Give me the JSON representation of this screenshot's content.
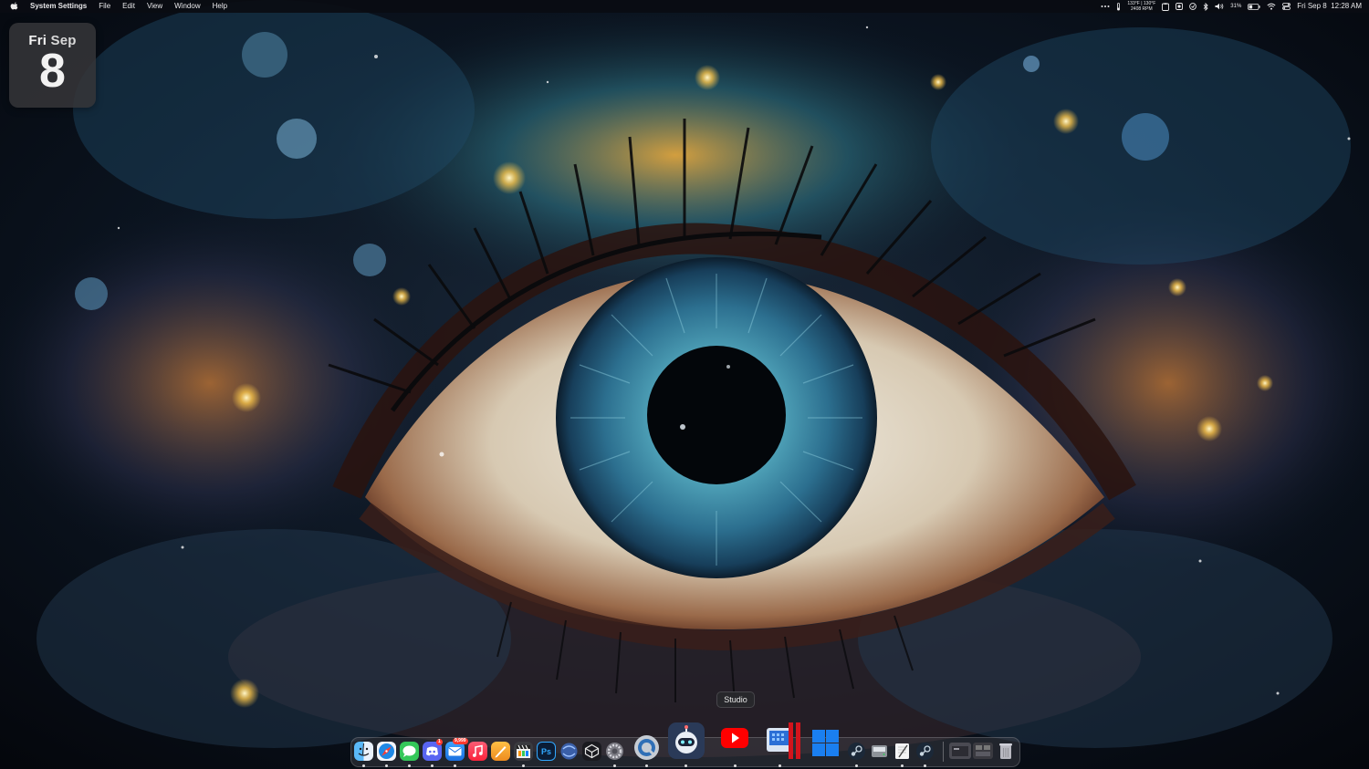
{
  "menubar": {
    "app_name": "System Settings",
    "menus": [
      "File",
      "Edit",
      "View",
      "Window",
      "Help"
    ],
    "temps_line1": "133°F | 130°F",
    "temps_line2": "2408 RPM",
    "battery_percent": "31%",
    "clock": "Fri Sep 8  12:28 AM"
  },
  "date_widget": {
    "weekday": "Fri",
    "month": "Sep",
    "day": "8"
  },
  "dock": {
    "tooltip": "Studio",
    "mail_badge": "9,999",
    "discord_badge": "1",
    "photoshop_label": "Ps",
    "items": [
      {
        "name": "finder-icon",
        "color": "#2f8ff0"
      },
      {
        "name": "safari-icon",
        "color": "#1e88e5"
      },
      {
        "name": "messages-icon",
        "color": "#34c759"
      },
      {
        "name": "discord-icon",
        "color": "#5865f2"
      },
      {
        "name": "mail-icon",
        "color": "#2a8cf4"
      },
      {
        "name": "music-icon",
        "color": "#fa2d48"
      },
      {
        "name": "pages-icon",
        "color": "#f0a431"
      },
      {
        "name": "claquette-icon",
        "color": "#3a3a3f"
      },
      {
        "name": "photoshop-icon",
        "color": "#0b1d36"
      },
      {
        "name": "browser-icon",
        "color": "#3a5fa8"
      },
      {
        "name": "game-icon",
        "color": "#1a1a1f"
      },
      {
        "name": "system-settings-icon",
        "color": "#7c7c84"
      },
      {
        "name": "quicktime-icon",
        "color": "#2f6fb6"
      },
      {
        "name": "robot-app-icon",
        "color": "#2a3a58"
      },
      {
        "name": "youtube-studio-icon",
        "color": "#ff0000"
      },
      {
        "name": "screens-icon",
        "color": "#2b6fd6"
      },
      {
        "name": "parallels-icon",
        "color": "#d4141c"
      },
      {
        "name": "windows-icon",
        "color": "#1a7ff0"
      },
      {
        "name": "steam-icon",
        "color": "#1b2838"
      },
      {
        "name": "disk-icon",
        "color": "#8e9399"
      },
      {
        "name": "textedit-icon",
        "color": "#f5f5f5"
      },
      {
        "name": "steam-2-icon",
        "color": "#1b2838"
      },
      {
        "name": "recent-folder-icon",
        "color": "#4a4a52"
      },
      {
        "name": "recent-window-icon",
        "color": "#3a3a40"
      },
      {
        "name": "trash-icon",
        "color": "#9a9aa2"
      }
    ]
  }
}
